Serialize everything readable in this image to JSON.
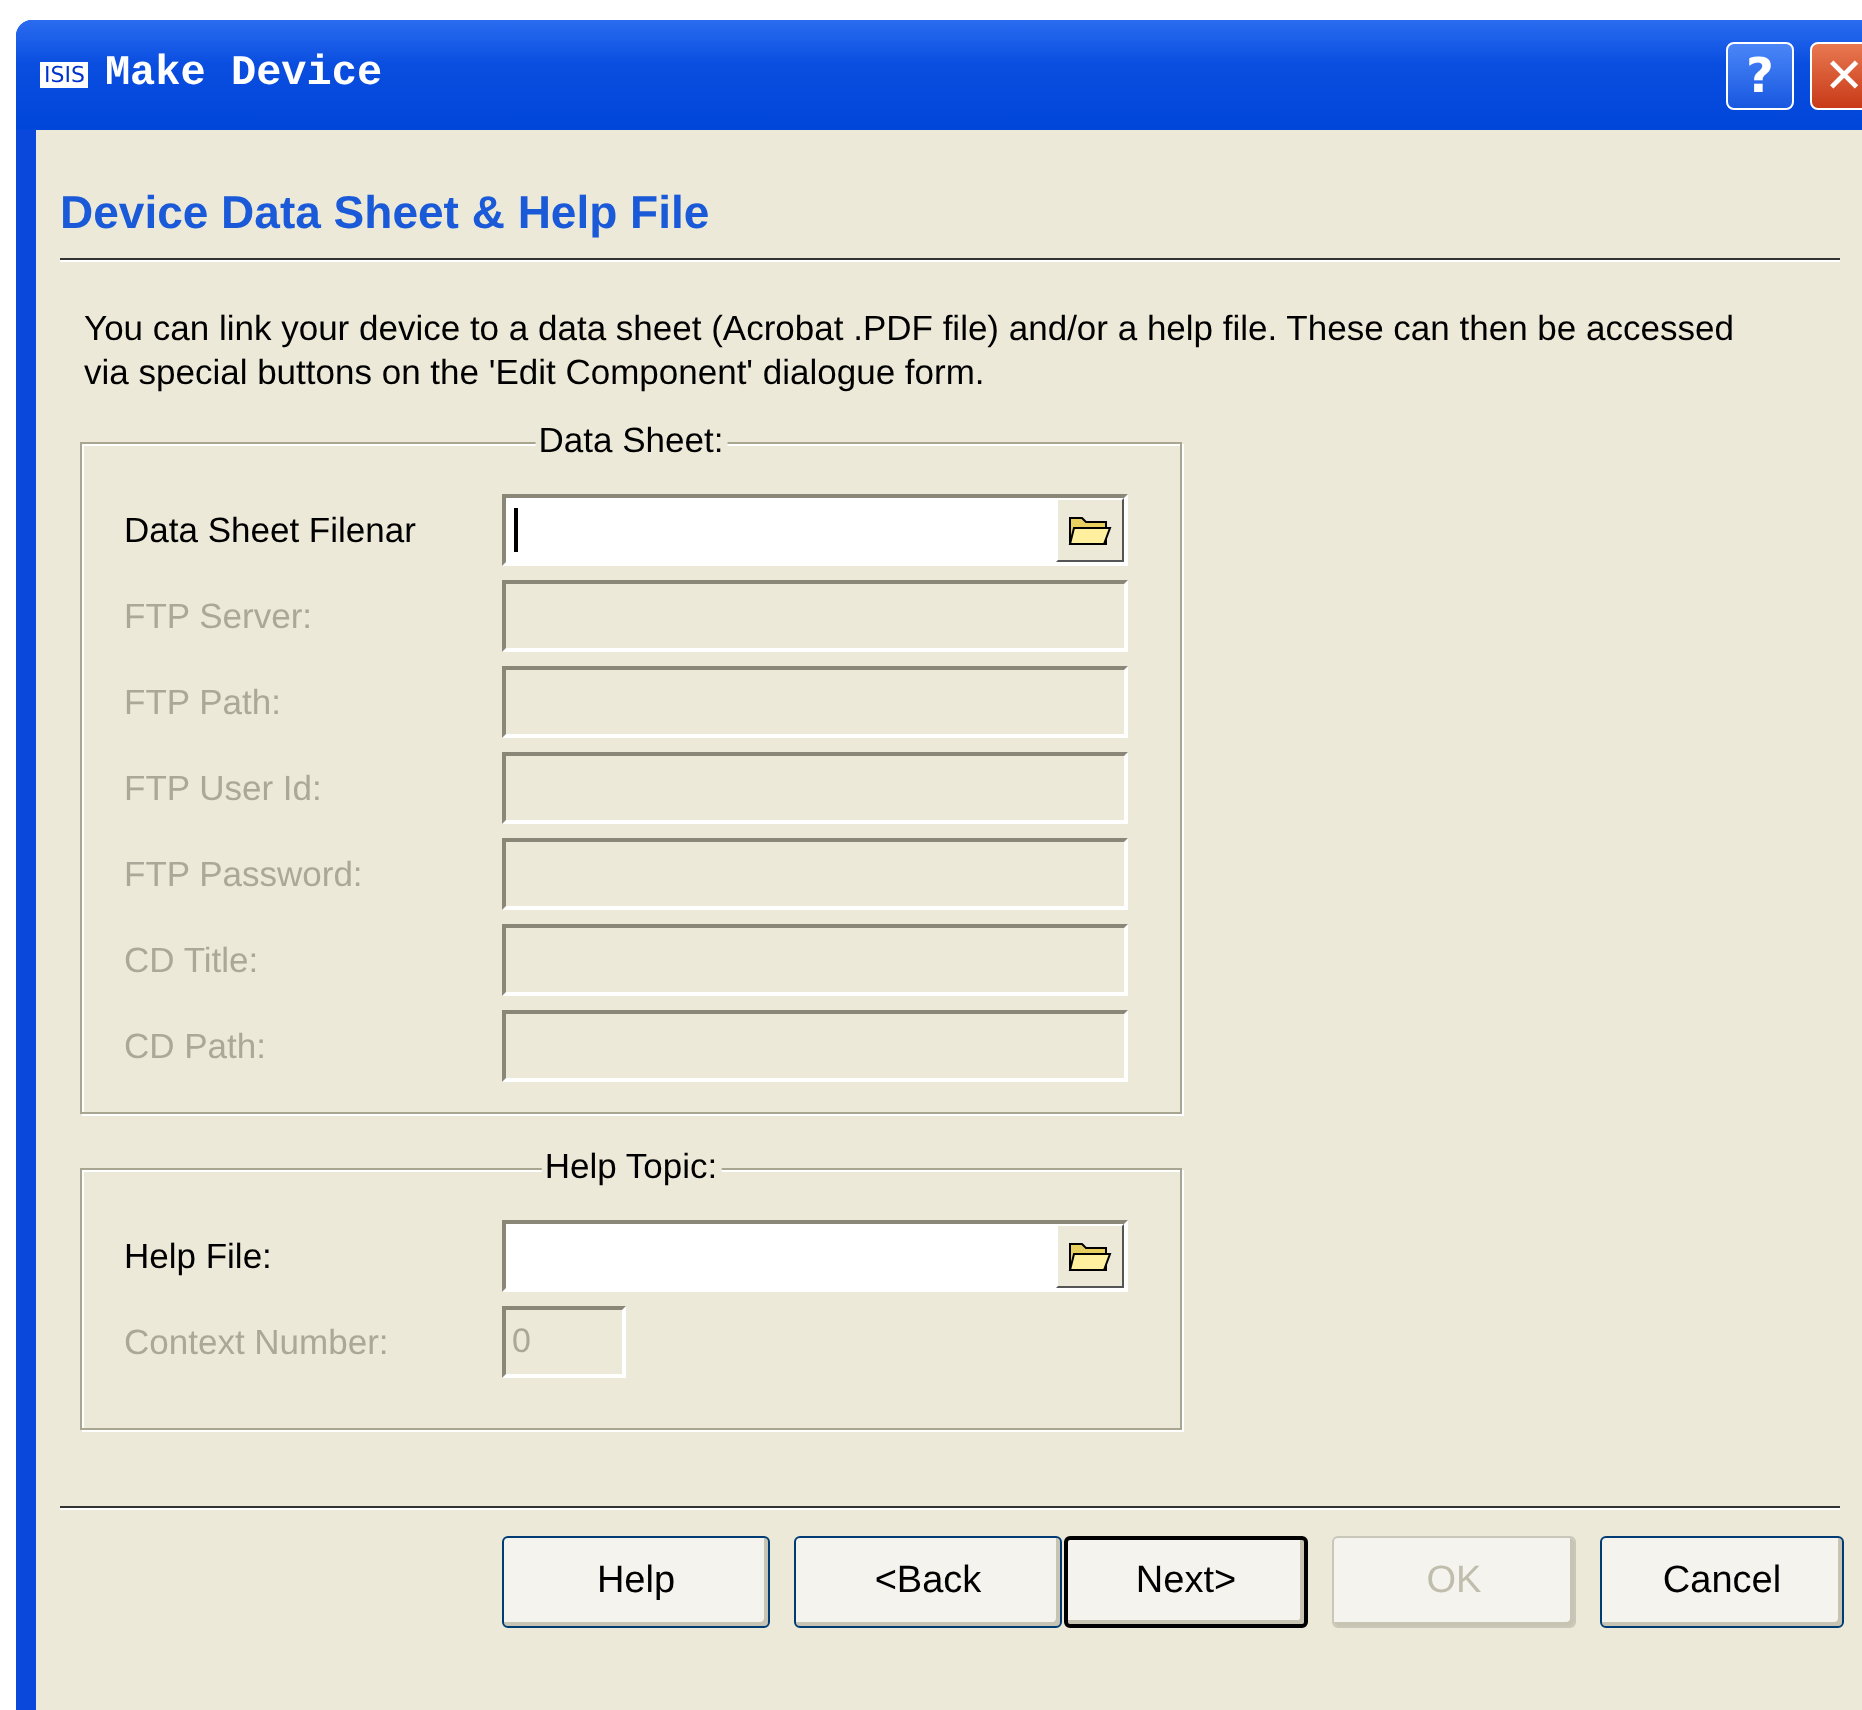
{
  "window": {
    "title": "Make Device",
    "app_badge": "ISIS"
  },
  "title_buttons": [
    {
      "kind": "help",
      "label": "?"
    },
    {
      "kind": "close",
      "label": "✕"
    }
  ],
  "heading": "Device Data Sheet & Help File",
  "description": "You can link your device to a data sheet (Acrobat .PDF file) and/or a help file. These can then be accessed via special buttons on the 'Edit Component' dialogue form.",
  "groups": [
    {
      "title": "Data Sheet:",
      "fields": [
        {
          "label": "Data Sheet Filenar",
          "kind": "file",
          "disabled": false,
          "focused": true
        },
        {
          "label": "FTP Server:",
          "kind": "text",
          "disabled": true
        },
        {
          "label": "FTP Path:",
          "kind": "text",
          "disabled": true
        },
        {
          "label": "FTP User Id:",
          "kind": "text",
          "disabled": true
        },
        {
          "label": "FTP Password:",
          "kind": "text",
          "disabled": true
        },
        {
          "label": "CD Title:",
          "kind": "text",
          "disabled": true
        },
        {
          "label": "CD Path:",
          "kind": "text",
          "disabled": true
        }
      ]
    },
    {
      "title": "Help Topic:",
      "fields": [
        {
          "label": "Help File:",
          "kind": "file",
          "disabled": false,
          "focused": false
        },
        {
          "label": "Context Number:",
          "kind": "number",
          "disabled": true,
          "value": "0"
        }
      ]
    }
  ],
  "buttons": [
    {
      "label": "Help",
      "disabled": false,
      "default": false
    },
    {
      "label": "<Back",
      "disabled": false,
      "default": false
    },
    {
      "label": "Next>",
      "disabled": false,
      "default": true
    },
    {
      "label": "OK",
      "disabled": true,
      "default": false
    },
    {
      "label": "Cancel",
      "disabled": false,
      "default": false
    }
  ]
}
